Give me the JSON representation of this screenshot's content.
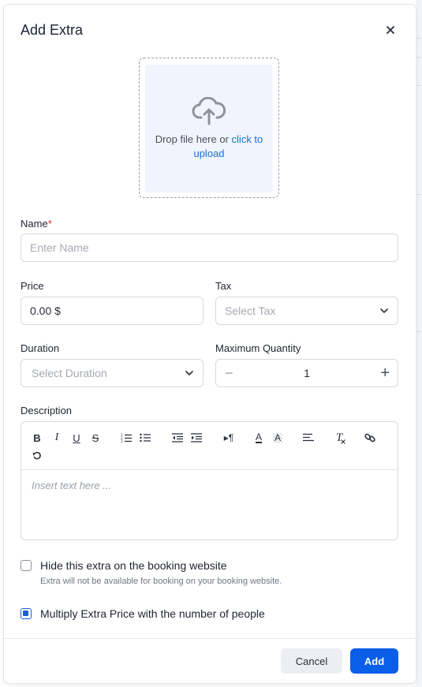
{
  "dialog": {
    "title": "Add Extra",
    "close_icon": "close-icon"
  },
  "upload": {
    "icon": "cloud-upload-icon",
    "text": "Drop file here or",
    "link_line1": "click to",
    "link_line2": "upload"
  },
  "name": {
    "label": "Name",
    "required_mark": "*",
    "placeholder": "Enter Name"
  },
  "price": {
    "label": "Price",
    "value": "0.00 $"
  },
  "tax": {
    "label": "Tax",
    "placeholder": "Select Tax"
  },
  "duration": {
    "label": "Duration",
    "placeholder": "Select Duration"
  },
  "max_quantity": {
    "label": "Maximum Quantity",
    "minus": "−",
    "value": "1",
    "plus": "+"
  },
  "description": {
    "label": "Description",
    "placeholder": "Insert text here ...",
    "toolbar": {
      "bold": "B",
      "italic": "I",
      "underline": "U",
      "strike": "S",
      "paragraph": "▸¶",
      "font_color": "A",
      "bg_color": "A",
      "clear_format": "T"
    }
  },
  "options": {
    "hide_label": "Hide this extra on the booking website",
    "hide_help": "Extra will not be available for booking on your booking website.",
    "hide_checked": false,
    "multiply_label": "Multiply Extra Price with the number of people",
    "multiply_checked": true
  },
  "footer": {
    "cancel": "Cancel",
    "add": "Add"
  },
  "colors": {
    "accent": "#0b5ee8",
    "link": "#1a6fd8",
    "required": "#d92d2d",
    "upload_bg": "#f0f4fc"
  }
}
